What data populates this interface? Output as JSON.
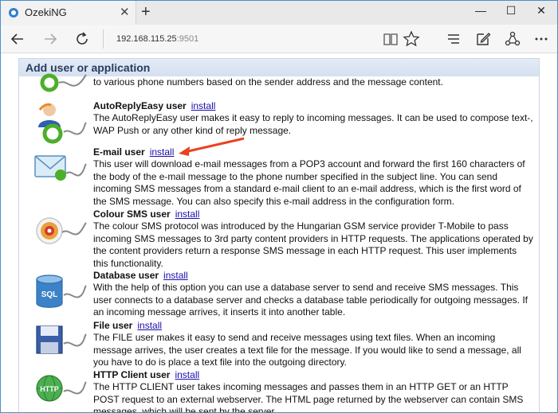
{
  "browser": {
    "tab_title": "OzekiNG",
    "tab_close": "✕",
    "new_tab": "+",
    "url_host": "192.168.115.25",
    "url_port": ":9501",
    "window_buttons": [
      "—",
      "☐",
      "✕"
    ]
  },
  "panel": {
    "title": "Add user or application"
  },
  "items": [
    {
      "name": "",
      "install": "",
      "description": "to various phone numbers based on the sender address and the message content.",
      "icon": "autoreply-user-icon"
    },
    {
      "name": "AutoReplyEasy user",
      "install": "install",
      "description": "The AutoReplyEasy user makes it easy to reply to incoming messages. It can be used to compose text-, WAP Push or any other kind of reply message.",
      "icon": "autoreply-easy-user-icon"
    },
    {
      "name": "E-mail user",
      "install": "install",
      "description": "This user will download e-mail messages from a POP3 account and forward the first 160 characters of the body of the e-mail message to the phone number specified in the subject line. You can send incoming SMS messages from a standard e-mail client to an e-mail address, which is the first word of the SMS message. You can also specify this e-mail address in the configuration form.",
      "icon": "email-user-icon"
    },
    {
      "name": "Colour SMS user",
      "install": "install",
      "description": "The colour SMS protocol was introduced by the Hungarian GSM service provider T-Mobile to pass incoming SMS messages to 3rd party content providers in HTTP requests. The applications operated by the content providers return a response SMS message in each HTTP request. This user implements this functionality.",
      "icon": "colour-sms-user-icon"
    },
    {
      "name": "Database user",
      "install": "install",
      "description": "With the help of this option you can use a database server to send and receive SMS messages. This user connects to a database server and checks a database table periodically for outgoing messages. If an incoming message arrives, it inserts it into another table.",
      "icon": "database-user-icon",
      "icon_label": "SQL"
    },
    {
      "name": "File user",
      "install": "install",
      "description": "The FILE user makes it easy to send and receive messages using text files. When an incoming message arrives, the user creates a text file for the message. If you would like to send a message, all you have to do is place a text file into the outgoing directory.",
      "icon": "file-user-icon"
    },
    {
      "name": "HTTP Client user",
      "install": "install",
      "description": "The HTTP CLIENT user takes incoming messages and passes them in an HTTP GET or an HTTP POST request to an external webserver. The HTML page returned by the webserver can contain SMS messages, which will be sent by the server.",
      "icon": "http-client-user-icon",
      "icon_label": "HTTP"
    }
  ],
  "colors": {
    "accent": "#1a0dab",
    "header_text": "#283c60",
    "arrow": "#e8431e"
  }
}
